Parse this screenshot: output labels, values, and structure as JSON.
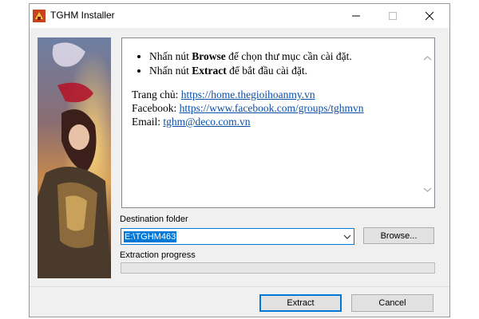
{
  "window": {
    "title": "TGHM Installer"
  },
  "info": {
    "bullets": [
      {
        "prefix": "Nhấn nút ",
        "bold": "Browse",
        "suffix": " để chọn thư mục cần cài đặt."
      },
      {
        "prefix": "Nhấn nút ",
        "bold": "Extract",
        "suffix": " để bắt đầu cài đặt."
      }
    ],
    "homepage_label": "Trang chủ: ",
    "homepage_link": "https://home.thegioihoanmy.vn",
    "facebook_label": "Facebook: ",
    "facebook_link": "https://www.facebook.com/groups/tghmvn",
    "email_label": "Email: ",
    "email_link": "tghm@deco.com.vn"
  },
  "destination": {
    "label": "Destination folder",
    "value": "E:\\TGHM463",
    "browse_label": "Browse..."
  },
  "progress": {
    "label": "Extraction progress",
    "fraction": 0
  },
  "footer": {
    "extract_label": "Extract",
    "cancel_label": "Cancel"
  },
  "colors": {
    "accent": "#0078d7",
    "link": "#0b4fa8"
  }
}
